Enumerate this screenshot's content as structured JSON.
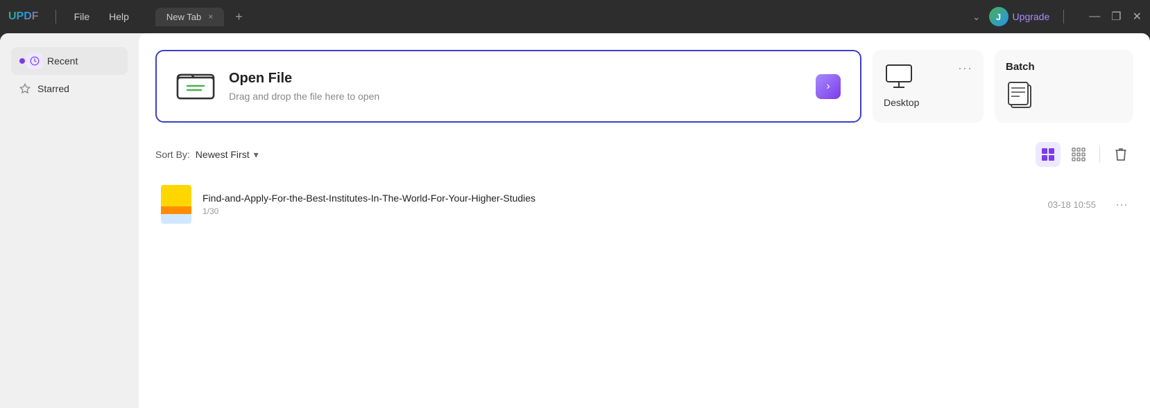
{
  "app": {
    "logo": "UPDF",
    "divider": "|"
  },
  "menu": {
    "file": "File",
    "help": "Help"
  },
  "titlebar": {
    "tab_label": "New Tab",
    "tab_close": "×",
    "tab_add": "+",
    "upgrade_avatar_letter": "J",
    "upgrade_label": "Upgrade",
    "win_minimize": "—",
    "win_maximize": "❐",
    "win_close": "✕"
  },
  "sidebar": {
    "items": [
      {
        "id": "recent",
        "label": "Recent",
        "icon": "clock-icon",
        "active": true
      },
      {
        "id": "starred",
        "label": "Starred",
        "icon": "star-icon",
        "active": false
      }
    ]
  },
  "open_file_card": {
    "title": "Open File",
    "subtitle": "Drag and drop the file here to open",
    "arrow": "›"
  },
  "desktop_card": {
    "label": "Desktop",
    "dots": "···"
  },
  "batch_card": {
    "title": "Batch"
  },
  "sort_bar": {
    "label": "Sort By:",
    "value": "Newest First",
    "chevron": "▾"
  },
  "view_toggle": {
    "list_view": "▦",
    "grid_view": "⊞",
    "delete": "🗑"
  },
  "files": [
    {
      "name": "Find-and-Apply-For-the-Best-Institutes-In-The-World-For-Your-Higher-Studies",
      "pages": "1/30",
      "date": "03-18 10:55",
      "thumb_color_top": "#f5c518",
      "thumb_color_bottom": "#e8e8e8"
    }
  ]
}
